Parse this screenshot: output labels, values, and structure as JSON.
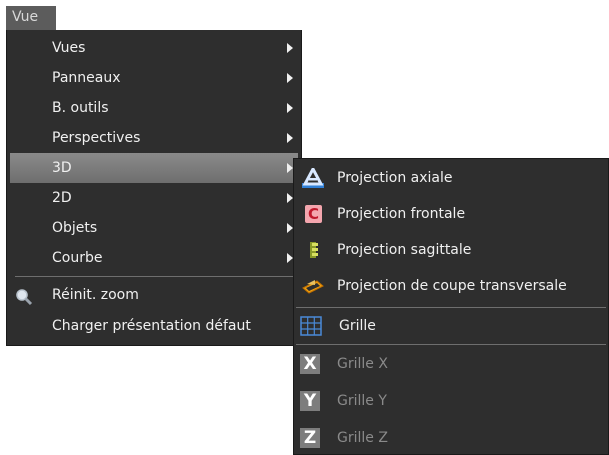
{
  "menubar": {
    "vue_label": "Vue"
  },
  "main_menu": {
    "vues": "Vues",
    "panneaux": "Panneaux",
    "b_outils": "B. outils",
    "perspectives": "Perspectives",
    "d3": "3D",
    "d2": "2D",
    "objets": "Objets",
    "courbe": "Courbe",
    "reinit_zoom": "Réinit. zoom",
    "charger": "Charger présentation défaut"
  },
  "submenu_3d": {
    "axiale": "Projection axiale",
    "frontale": "Projection frontale",
    "sagittale": "Projection sagittale",
    "transversale": "Projection de coupe transversale",
    "grille": "Grille",
    "grille_x": "Grille X",
    "grille_y": "Grille Y",
    "grille_z": "Grille Z",
    "icon_x": "X",
    "icon_y": "Y",
    "icon_z": "Z",
    "icon_c": "C"
  }
}
